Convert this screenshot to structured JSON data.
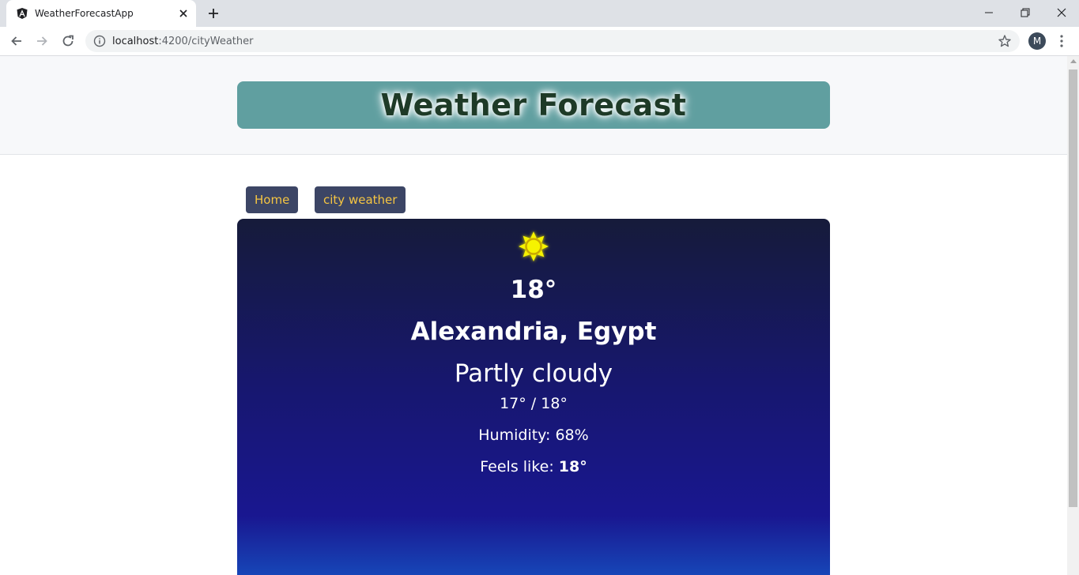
{
  "browser": {
    "tab_title": "WeatherForecastApp",
    "url_host": "localhost",
    "url_rest": ":4200/cityWeather",
    "profile_initial": "M"
  },
  "header": {
    "title": "Weather Forecast",
    "banner_color": "#609fa0"
  },
  "nav": {
    "home_label": "Home",
    "city_label": "city weather",
    "button_color": "#3c4565",
    "text_color": "#f5c542"
  },
  "weather": {
    "icon": "sun-icon",
    "temperature": "18°",
    "location": "Alexandria, Egypt",
    "condition": "Partly cloudy",
    "min_max": "17° / 18°",
    "humidity": "Humidity: 68%",
    "feels_label": "Feels like: ",
    "feels_value": "18°"
  }
}
